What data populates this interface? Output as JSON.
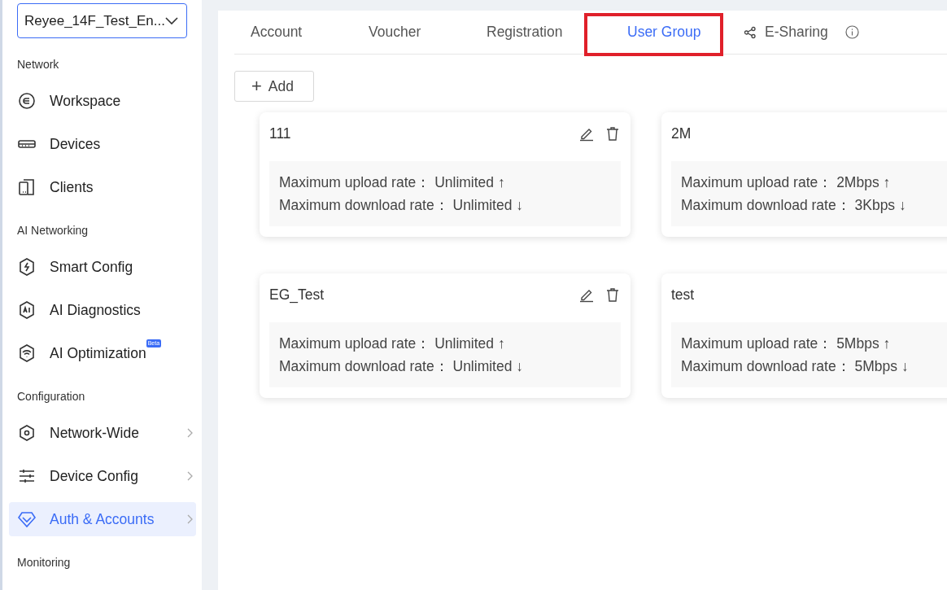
{
  "site_selector": {
    "value": "Reyee_14F_Test_En..."
  },
  "sidebar": {
    "sections": [
      {
        "title": "Network",
        "items": [
          {
            "label": "Workspace",
            "selected": false,
            "expandable": false
          },
          {
            "label": "Devices",
            "selected": false,
            "expandable": false
          },
          {
            "label": "Clients",
            "selected": false,
            "expandable": false
          }
        ]
      },
      {
        "title": "AI Networking",
        "items": [
          {
            "label": "Smart Config",
            "selected": false,
            "expandable": false
          },
          {
            "label": "AI Diagnostics",
            "selected": false,
            "expandable": false
          },
          {
            "label": "AI Optimization",
            "badge": "Beta",
            "selected": false,
            "expandable": false
          }
        ]
      },
      {
        "title": "Configuration",
        "items": [
          {
            "label": "Network-Wide",
            "selected": false,
            "expandable": true
          },
          {
            "label": "Device Config",
            "selected": false,
            "expandable": true
          },
          {
            "label": "Auth & Accounts",
            "selected": true,
            "expandable": true
          }
        ]
      },
      {
        "title": "Monitoring"
      }
    ]
  },
  "tabs": [
    {
      "label": "Account",
      "selected": false,
      "highlighted": false
    },
    {
      "label": "Voucher",
      "selected": false,
      "highlighted": false
    },
    {
      "label": "Registration",
      "selected": false,
      "highlighted": false
    },
    {
      "label": "User Group",
      "selected": true,
      "highlighted": true
    },
    {
      "label": "E-Sharing",
      "selected": false,
      "highlighted": false
    }
  ],
  "add_button": {
    "icon": "+",
    "label": "Add"
  },
  "groups": [
    {
      "name": "111",
      "upload": {
        "label": "Maximum upload rate：",
        "value": "Unlimited",
        "arrow": "↑"
      },
      "download": {
        "label": "Maximum download rate：",
        "value": "Unlimited",
        "arrow": "↓"
      }
    },
    {
      "name": "2M",
      "upload": {
        "label": "Maximum upload rate：",
        "value": "2Mbps",
        "arrow": "↑"
      },
      "download": {
        "label": "Maximum download rate：",
        "value": "3Kbps",
        "arrow": "↓"
      }
    },
    {
      "name": "EG_Test",
      "upload": {
        "label": "Maximum upload rate：",
        "value": "Unlimited",
        "arrow": "↑"
      },
      "download": {
        "label": "Maximum download rate：",
        "value": "Unlimited",
        "arrow": "↓"
      }
    },
    {
      "name": "test",
      "upload": {
        "label": "Maximum upload rate：",
        "value": "5Mbps",
        "arrow": "↑"
      },
      "download": {
        "label": "Maximum download rate：",
        "value": "5Mbps",
        "arrow": "↓"
      }
    }
  ]
}
